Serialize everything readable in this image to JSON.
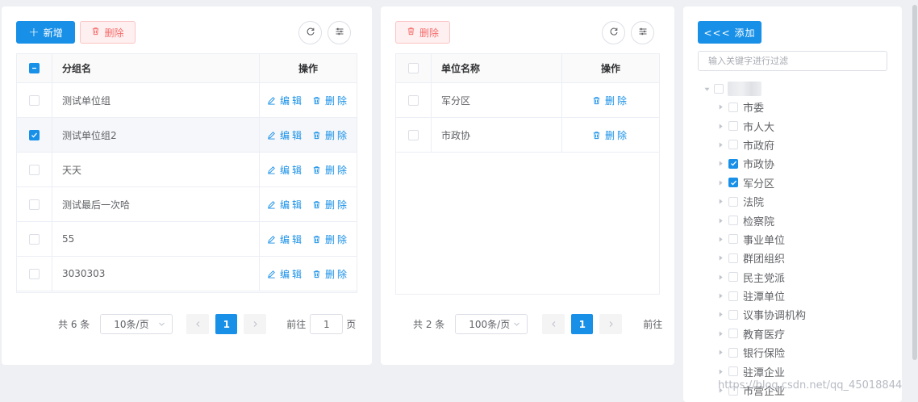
{
  "group_panel": {
    "add_label": "新增",
    "delete_label": "删除",
    "table": {
      "col_name": "分组名",
      "col_op": "操作",
      "rows": [
        {
          "name": "测试单位组",
          "checked": false
        },
        {
          "name": "测试单位组2",
          "checked": true
        },
        {
          "name": "天天",
          "checked": false
        },
        {
          "name": "测试最后一次哈",
          "checked": false
        },
        {
          "name": "55",
          "checked": false
        },
        {
          "name": "3030303",
          "checked": false
        }
      ],
      "edit_label": "编辑",
      "delete_label": "删除"
    },
    "pager": {
      "total": "共 6 条",
      "page_size": "10条/页",
      "current_page": "1",
      "jump_prefix": "前往",
      "jump_value": "1",
      "jump_suffix": "页"
    }
  },
  "unit_panel": {
    "delete_label": "删除",
    "table": {
      "col_name": "单位名称",
      "col_op": "操作",
      "rows": [
        {
          "name": "军分区",
          "checked": false
        },
        {
          "name": "市政协",
          "checked": false
        }
      ],
      "delete_label": "删除"
    },
    "pager": {
      "total": "共 2 条",
      "page_size": "100条/页",
      "current_page": "1",
      "jump_prefix": "前往"
    }
  },
  "tree_panel": {
    "add_label": "<<< 添加",
    "filter_placeholder": "输入关键字进行过滤",
    "nodes": [
      {
        "label": "市委",
        "checked": false
      },
      {
        "label": "市人大",
        "checked": false
      },
      {
        "label": "市政府",
        "checked": false
      },
      {
        "label": "市政协",
        "checked": true
      },
      {
        "label": "军分区",
        "checked": true
      },
      {
        "label": "法院",
        "checked": false
      },
      {
        "label": "检察院",
        "checked": false
      },
      {
        "label": "事业单位",
        "checked": false
      },
      {
        "label": "群团组织",
        "checked": false
      },
      {
        "label": "民主党派",
        "checked": false
      },
      {
        "label": "驻潭单位",
        "checked": false
      },
      {
        "label": "议事协调机构",
        "checked": false
      },
      {
        "label": "教育医疗",
        "checked": false
      },
      {
        "label": "银行保险",
        "checked": false
      },
      {
        "label": "驻潭企业",
        "checked": false
      },
      {
        "label": "市营企业",
        "checked": false
      }
    ]
  },
  "watermark": "https://blog.csdn.net/qq_45018844",
  "colors": {
    "primary": "#1890e8",
    "danger": "#f56c6c"
  }
}
